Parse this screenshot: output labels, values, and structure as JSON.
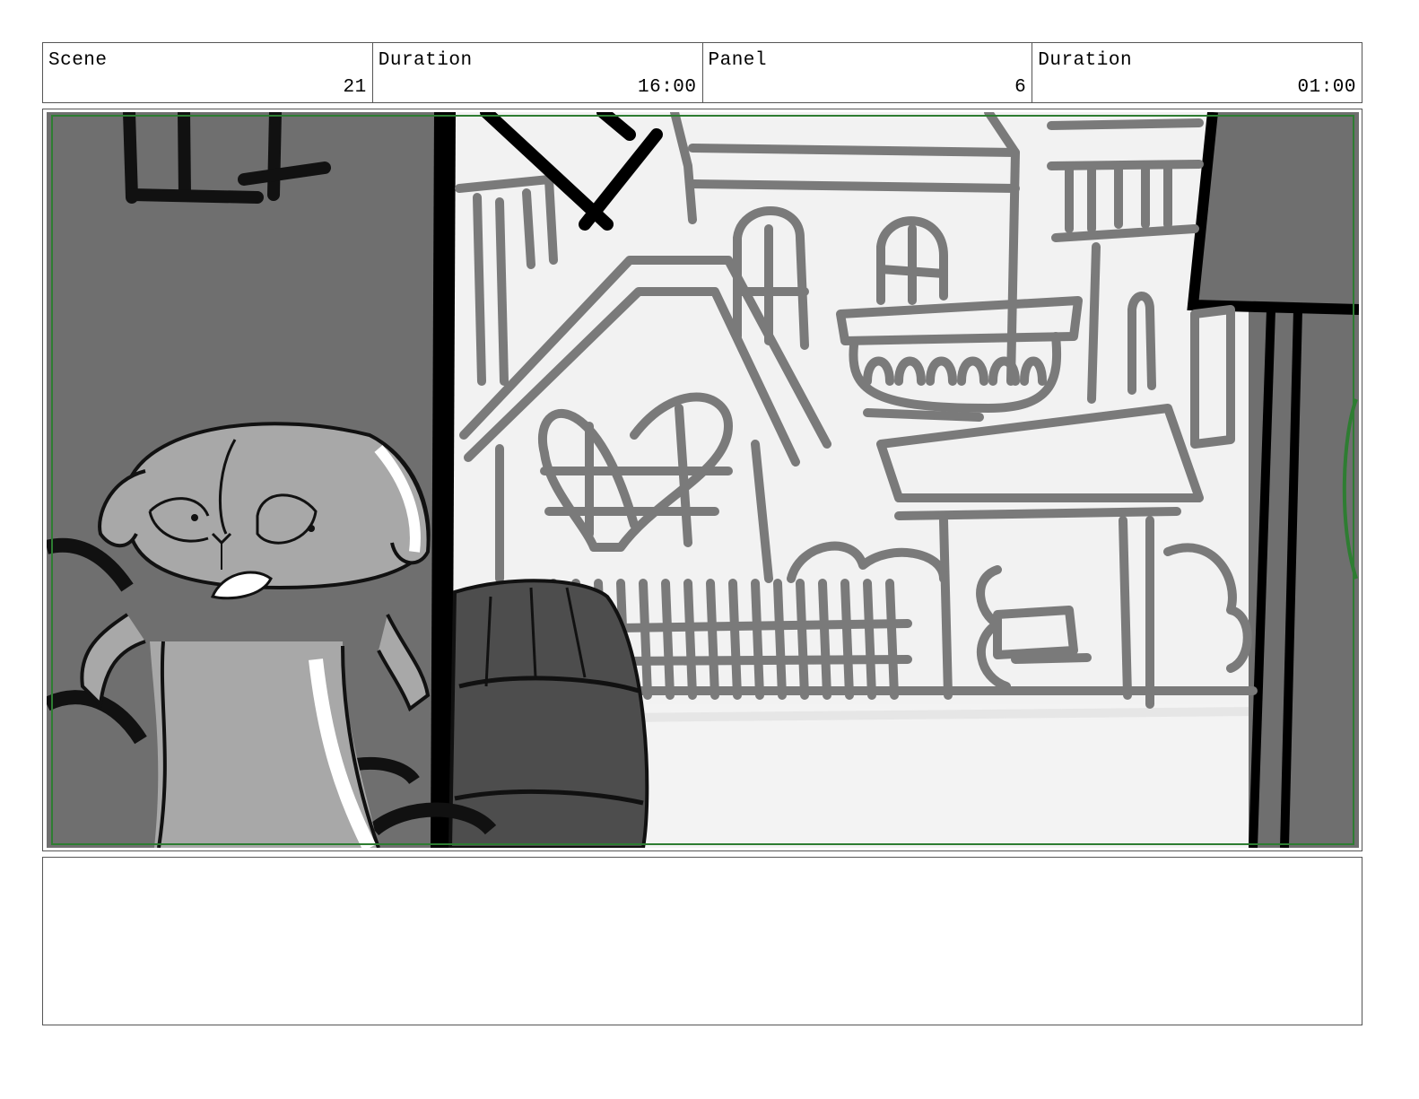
{
  "header": {
    "scene_label": "Scene",
    "scene_value": "21",
    "scene_duration_label": "Duration",
    "scene_duration_value": "16:00",
    "panel_label": "Panel",
    "panel_value": "6",
    "panel_duration_label": "Duration",
    "panel_duration_value": "01:00"
  },
  "panel": {
    "safe_frame_color": "#2e7d32"
  },
  "notes": {
    "text": ""
  }
}
